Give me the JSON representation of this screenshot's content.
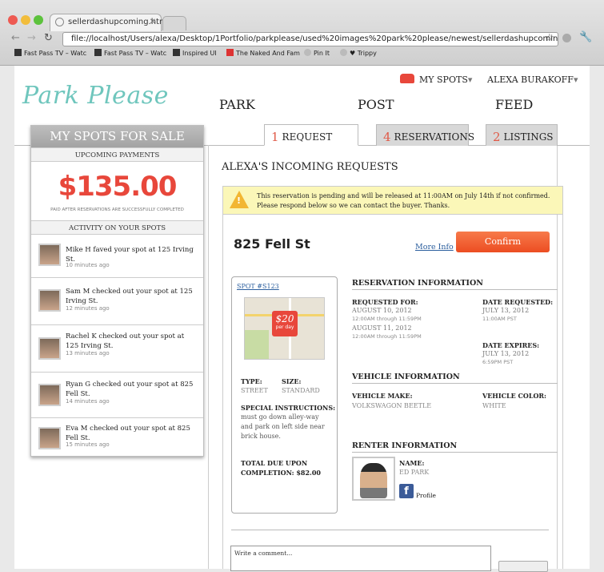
{
  "browser": {
    "tab_title": "sellerdashupcoming.html",
    "url": "file://localhost/Users/alexa/Desktop/1Portfolio/parkplease/used%20images%20park%20please/newest/sellerdashupcoming.html",
    "bookmarks": [
      "Fast Pass TV – Watc",
      "Fast Pass TV – Watc",
      "Inspired UI",
      "The Naked And Fam",
      "Pin It",
      "♥ Trippy"
    ]
  },
  "brand": {
    "logo": "Park Please"
  },
  "topnav": {
    "my_spots": "MY SPOTS",
    "user": "ALEXA BURAKOFF",
    "links": [
      "PARK",
      "POST",
      "FEED"
    ]
  },
  "sidebar": {
    "title": "MY SPOTS FOR SALE",
    "upcoming_label": "UPCOMING PAYMENTS",
    "amount": "$135.00",
    "amount_note": "PAID AFTER RESERVATIONS ARE SUCCESSFULLY COMPLETED",
    "activity_label": "ACTIVITY ON YOUR SPOTS",
    "activity": [
      {
        "text": "Mike H faved your spot at 125 Irving St.",
        "time": "10 minutes ago"
      },
      {
        "text": "Sam M checked out your spot at 125 Irving St.",
        "time": "12 minutes ago"
      },
      {
        "text": "Rachel K checked out your spot at 125 Irving St.",
        "time": "13 minutes ago"
      },
      {
        "text": "Ryan G checked out your spot at 825 Fell St.",
        "time": "14 minutes ago"
      },
      {
        "text": "Eva M checked out your spot at 825 Fell St.",
        "time": "15 minutes ago"
      }
    ]
  },
  "tabs": [
    {
      "num": "1",
      "label": "REQUEST"
    },
    {
      "num": "4",
      "label": "RESERVATIONS"
    },
    {
      "num": "2",
      "label": "LISTINGS"
    }
  ],
  "main": {
    "heading": "ALEXA'S INCOMING REQUESTS",
    "warning": "This reservation is pending and will be released at 11:00AM on July 14th if not confirmed. Please respond below so we can contact the buyer. Thanks.",
    "address": "825 Fell St",
    "more_info": "More Info",
    "confirm": "Confirm",
    "spot": {
      "id": "SPOT #S123",
      "price": "$20",
      "price_unit": "per day",
      "type_label": "TYPE:",
      "type": "STREET",
      "size_label": "SIZE:",
      "size": "STANDARD",
      "instr_label": "SPECIAL INSTRUCTIONS:",
      "instr": "must go down alley-way and park on left side near brick house.",
      "total_label": "TOTAL DUE UPON COMPLETION: $82.00"
    },
    "reservation": {
      "title": "RESERVATION INFORMATION",
      "requested_for": "REQUESTED FOR:",
      "date1": "AUGUST 10, 2012",
      "time1": "12:00AM through 11:59PM",
      "date2": "AUGUST 11, 2012",
      "time2": "12:00AM through 11:59PM",
      "date_requested_label": "DATE REQUESTED:",
      "date_requested": "JULY 13, 2012",
      "date_requested_time": "11:00AM PST",
      "date_expires_label": "DATE EXPIRES:",
      "date_expires": "JULY 13, 2012",
      "date_expires_time": "6:59PM PST"
    },
    "vehicle": {
      "title": "VEHICLE INFORMATION",
      "make_label": "VEHICLE MAKE:",
      "make": "VOLKSWAGON BEETLE",
      "color_label": "VEHICLE COLOR:",
      "color": "WHITE"
    },
    "renter": {
      "title": "RENTER INFORMATION",
      "name_label": "NAME:",
      "name": "ED PARK",
      "profile": "Profile"
    },
    "comment_placeholder": "Write a comment..."
  },
  "colors": {
    "accent": "#e8473b",
    "logo": "#6fc6bd",
    "warning_bg": "#fbf7b8",
    "confirm": "#f25c2e"
  }
}
